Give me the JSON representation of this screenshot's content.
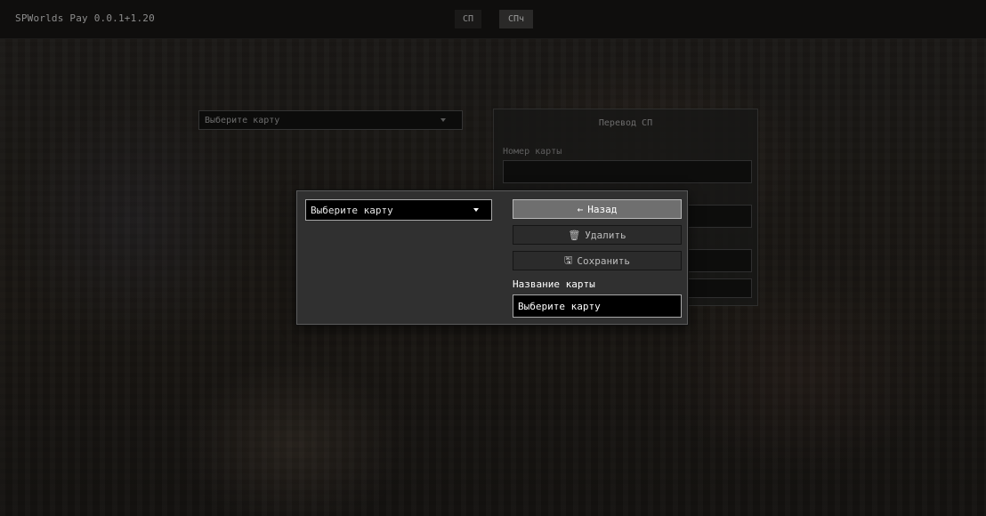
{
  "app": {
    "title": "SPWorlds Pay 0.0.1+1.20"
  },
  "tabs": [
    {
      "label": "СП"
    },
    {
      "label": "СПч"
    }
  ],
  "background": {
    "card_select": {
      "value": "Выберите карту"
    },
    "transfer_panel": {
      "title": "Перевод СП",
      "card_number_label": "Номер карты"
    }
  },
  "dialog": {
    "card_select": {
      "value": "Выберите карту"
    },
    "back_button": {
      "icon": "arrow-left-icon",
      "glyph": "←",
      "label": "Назад"
    },
    "delete_button": {
      "icon": "trash-icon",
      "glyph": "🗑",
      "label": "Удалить"
    },
    "save_button": {
      "icon": "floppy-disk-icon",
      "glyph": "🖫",
      "label": "Сохранить"
    },
    "card_name": {
      "label": "Название карты",
      "value": "Выберите карту"
    }
  }
}
